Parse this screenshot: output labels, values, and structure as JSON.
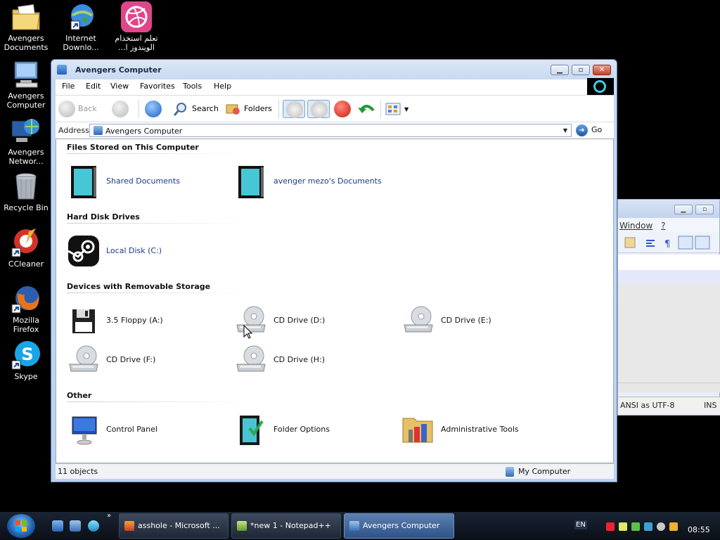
{
  "desktop": {
    "icons": [
      {
        "label": "Avengers Documents"
      },
      {
        "label": "Internet Downlo..."
      },
      {
        "label": "تعلم استخدام الويندوز ا..."
      },
      {
        "label": "Avengers Computer"
      },
      {
        "label": "Avengers Networ..."
      },
      {
        "label": "Recycle Bin"
      },
      {
        "label": "CCleaner"
      },
      {
        "label": "Mozilla Firefox"
      },
      {
        "label": "Skype"
      }
    ]
  },
  "notepad": {
    "menu": [
      "Window",
      "?"
    ],
    "status_encoding": "ANSI as UTF-8",
    "status_mode": "INS"
  },
  "explorer": {
    "title": "Avengers Computer",
    "menu": [
      "File",
      "Edit",
      "View",
      "Favorites",
      "Tools",
      "Help"
    ],
    "toolbar": {
      "back": "Back",
      "search": "Search",
      "folders": "Folders"
    },
    "address": {
      "label": "Address",
      "value": "Avengers Computer",
      "go": "Go"
    },
    "groups": [
      {
        "title": "Files Stored on This Computer",
        "items": [
          "Shared Documents",
          "avenger mezo's Documents"
        ]
      },
      {
        "title": "Hard Disk Drives",
        "items": [
          "Local Disk (C:)"
        ]
      },
      {
        "title": "Devices with Removable Storage",
        "items": [
          "3.5 Floppy (A:)",
          "CD Drive (D:)",
          "CD Drive (E:)",
          "CD Drive (F:)",
          "CD Drive (H:)"
        ]
      },
      {
        "title": "Other",
        "items": [
          "Control Panel",
          "Folder Options",
          "Administrative Tools"
        ]
      }
    ],
    "status": {
      "count": "11 objects",
      "zone": "My Computer"
    }
  },
  "taskbar": {
    "items": [
      "asshole - Microsoft ...",
      "*new  1 - Notepad++",
      "Avengers Computer"
    ],
    "lang": "EN",
    "time": "08:55"
  },
  "colors": {
    "accent": "#2f5388",
    "link": "#1b3a8a"
  }
}
